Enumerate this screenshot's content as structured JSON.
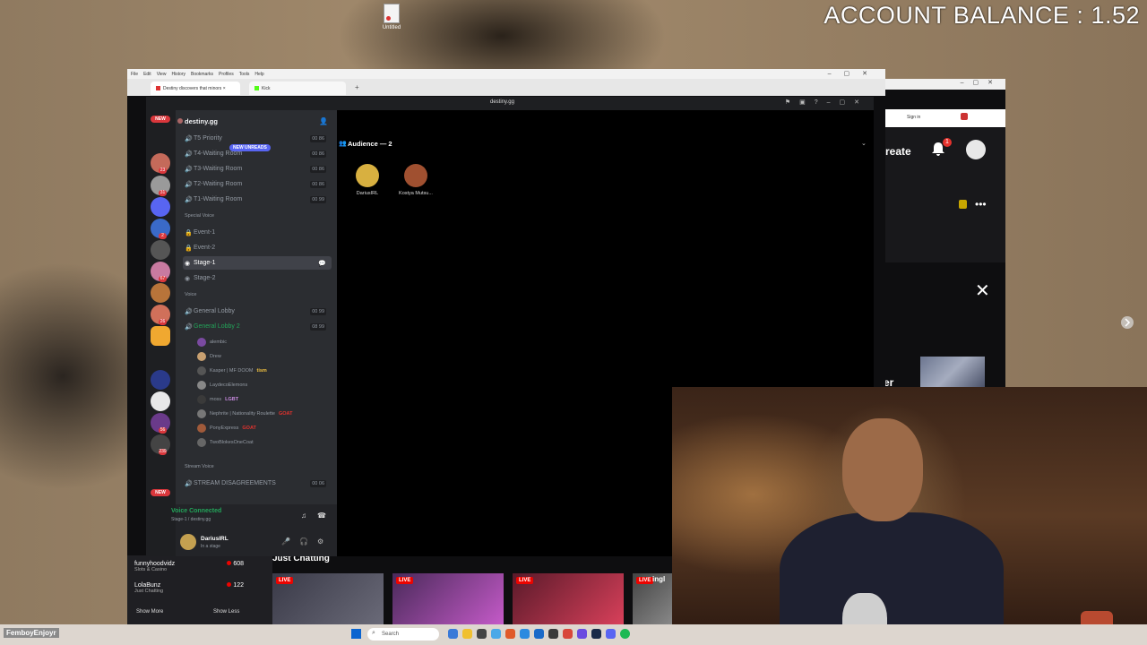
{
  "desktop": {
    "account_balance": "ACCOUNT BALANCE : 1.52",
    "icon_label": "Untitled"
  },
  "browser": {
    "menu": [
      "File",
      "Edit",
      "View",
      "History",
      "Bookmarks",
      "Profiles",
      "Tools",
      "Help"
    ],
    "tabs": [
      "Destiny discovers that minors ×",
      "Kick"
    ],
    "create_label": "reate",
    "bell_badge": "1",
    "signin_label": "Sign in"
  },
  "twitch": {
    "side_channels": [
      {
        "name": "funnyhoodvidz",
        "category": "Slots & Casino",
        "viewers": "608"
      },
      {
        "name": "LolaBunz",
        "category": "Just Chatting",
        "viewers": "122"
      }
    ],
    "show_more": "Show More",
    "show_less": "Show Less",
    "section_title": "Just Chatting",
    "live_label": "LIVE",
    "partial_text": "ingl",
    "side_partial": "er"
  },
  "discord": {
    "window_title": "destiny.gg",
    "server_name": "destiny.gg",
    "new_unreads": "NEW UNREADS",
    "new_label": "NEW",
    "guild_badges": [
      "4",
      "23",
      "31",
      "5",
      "2",
      "1",
      "67",
      "21",
      "26",
      "56",
      "239"
    ],
    "channels_top": [
      {
        "name": "T5 Priority",
        "count": "00 86"
      },
      {
        "name": "T4-Waiting Room",
        "count": "00 86"
      },
      {
        "name": "T3-Waiting Room",
        "count": "00 86"
      },
      {
        "name": "T2-Waiting Room",
        "count": "00 86"
      },
      {
        "name": "T1-Waiting Room",
        "count": "00 99"
      }
    ],
    "category_special": "Special Voice",
    "special_channels": [
      "Event-1",
      "Event-2",
      "Stage-1",
      "Stage-2"
    ],
    "category_voice": "Voice",
    "general_lobby": {
      "name": "General Lobby",
      "count": "00 99"
    },
    "general_lobby_2": {
      "name": "General Lobby 2",
      "count": "08 99"
    },
    "users": [
      {
        "name": "alembic",
        "tag": ""
      },
      {
        "name": "Drew",
        "tag": ""
      },
      {
        "name": "Kasper | MF DOOM",
        "tag": "tism"
      },
      {
        "name": "LaydecoElemons",
        "tag": ""
      },
      {
        "name": "moss",
        "tag": "LGBT"
      },
      {
        "name": "Nephrite | Nationality Roulette",
        "tag": "GOAT"
      },
      {
        "name": "PonyExpress",
        "tag": "GOAT"
      },
      {
        "name": "TwoBlokesOneCoat",
        "tag": ""
      }
    ],
    "category_stream": "Stream Voice",
    "stream_channel": {
      "name": "STREAM DISAGREEMENTS",
      "count": "00 06"
    },
    "voice_connected": "Voice Connected",
    "voice_sub": "Stage-1 / destiny.gg",
    "username": "DariusIRL",
    "user_status": "In a stage",
    "audience_header": "Audience — 2",
    "audience": [
      "DariusIRL",
      "Kostya Mutsu..."
    ]
  },
  "taskbar": {
    "chat_user": "FemboyEnjoyr",
    "search_placeholder": "Search"
  },
  "colors": {
    "discord_green": "#23a55a",
    "discord_red": "#da373c",
    "twitch_live": "#eb0400"
  }
}
